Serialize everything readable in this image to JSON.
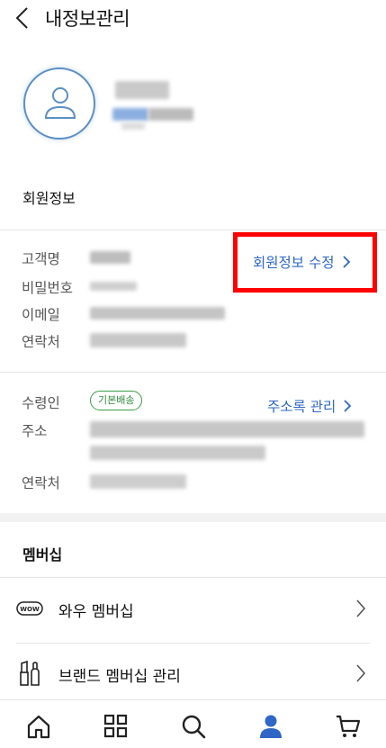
{
  "header": {
    "title": "내정보관리",
    "back_icon": "chevron-left-icon"
  },
  "member_info": {
    "section_title": "회원정보",
    "labels": {
      "name": "고객명",
      "password": "비밀번호",
      "email": "이메일",
      "phone": "연락처"
    },
    "edit_link": "회원정보 수정"
  },
  "address": {
    "labels": {
      "recipient": "수령인",
      "address": "주소",
      "phone": "연락처"
    },
    "badge": "기본배송",
    "manage_link": "주소록 관리"
  },
  "membership": {
    "section_title": "멤버십",
    "items": [
      {
        "label": "와우 멤버십",
        "icon": "wow-badge-icon"
      },
      {
        "label": "브랜드 멤버십 관리",
        "icon": "cosmetics-icon"
      }
    ]
  },
  "tabbar": {
    "tabs": [
      "home-icon",
      "categories-icon",
      "search-icon",
      "my-account-icon",
      "cart-icon"
    ],
    "active_color": "#2e67c6"
  },
  "colors": {
    "accent": "#2e67c6",
    "badge_green": "#2e8a3a",
    "highlight": "#ff0000"
  }
}
